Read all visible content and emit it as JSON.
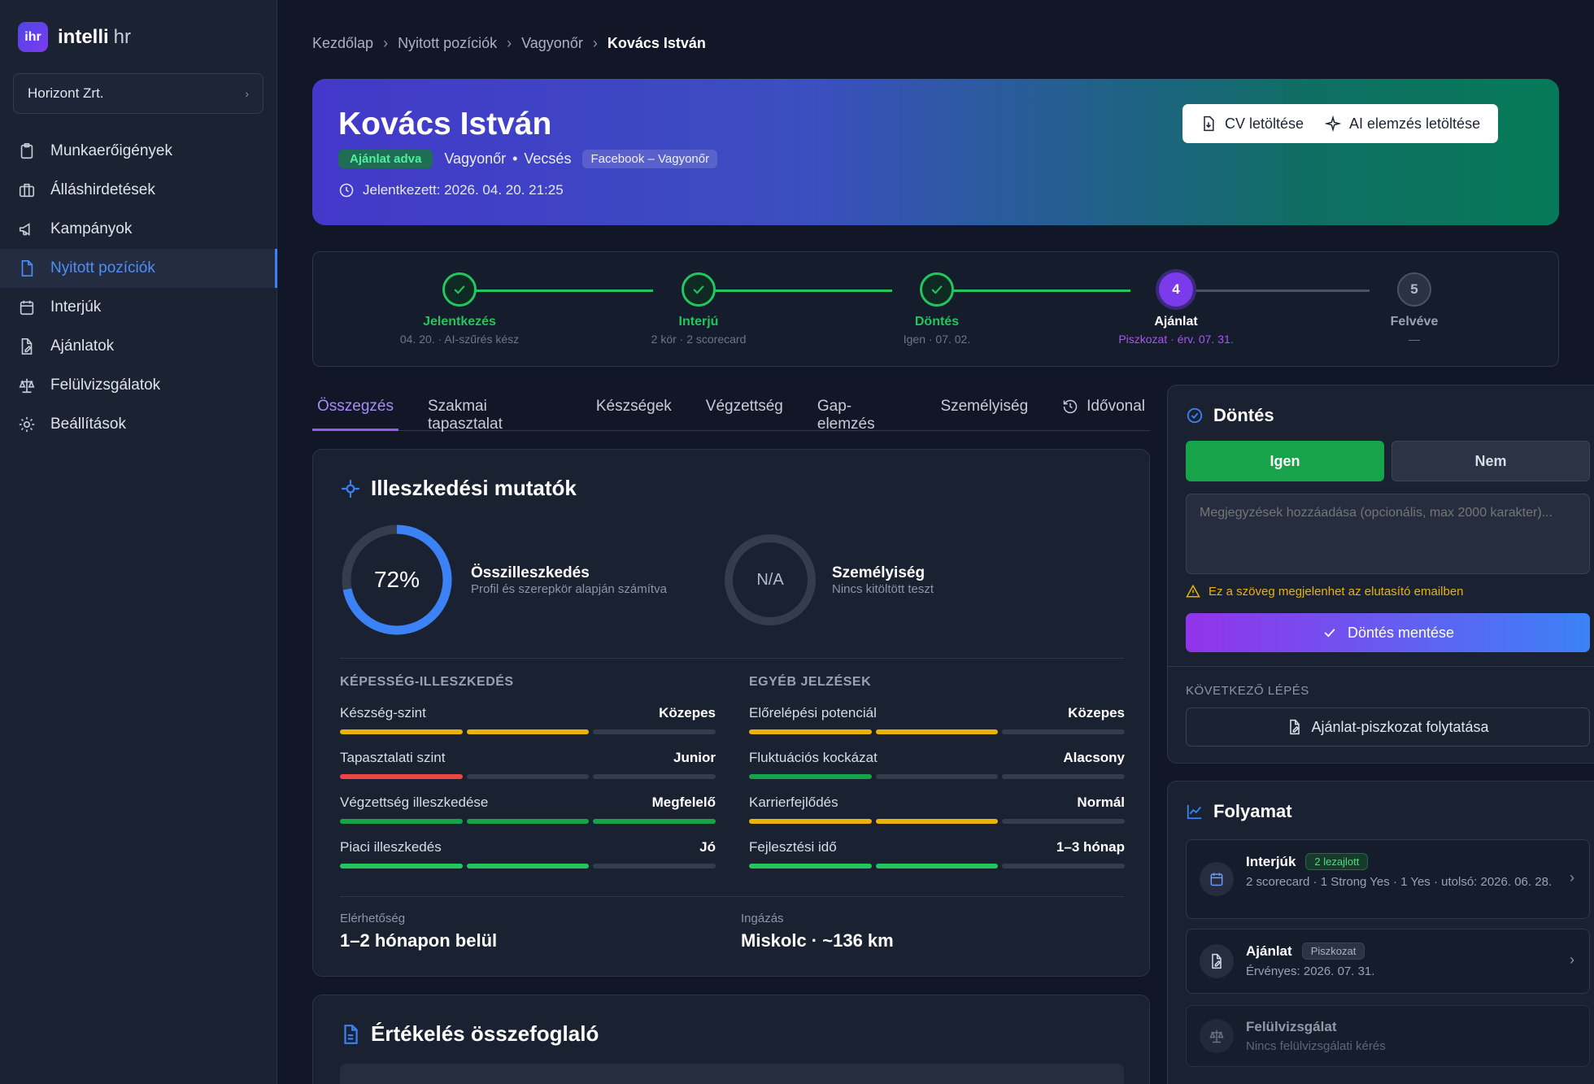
{
  "logo": {
    "badge": "ihr",
    "name": "intelli",
    "suffix": "hr"
  },
  "org": {
    "name": "Horizont Zrt.",
    "chevron": "›"
  },
  "nav": [
    {
      "label": "Munkaerőigények",
      "icon": "clipboard-icon"
    },
    {
      "label": "Álláshirdetések",
      "icon": "briefcase-icon"
    },
    {
      "label": "Kampányok",
      "icon": "megaphone-icon"
    },
    {
      "label": "Nyitott pozíciók",
      "icon": "file-icon",
      "active": true
    },
    {
      "label": "Interjúk",
      "icon": "calendar-icon"
    },
    {
      "label": "Ajánlatok",
      "icon": "file-edit-icon"
    },
    {
      "label": "Felülvizsgálatok",
      "icon": "scale-icon"
    },
    {
      "label": "Beállítások",
      "icon": "gear-icon"
    }
  ],
  "breadcrumb": {
    "items": [
      "Kezdőlap",
      "Nyitott pozíciók",
      "Vagyonőr"
    ],
    "current": "Kovács István",
    "sep": "›"
  },
  "hero": {
    "name": "Kovács István",
    "status": "Ajánlat adva",
    "role": "Vagyonőr",
    "dot": "•",
    "location": "Vecsés",
    "source": "Facebook – Vagyonőr",
    "applied": "Jelentkezett: 2026. 04. 20. 21:25",
    "btn_cv": "CV letöltése",
    "btn_ai": "AI elemzés letöltése"
  },
  "stepper": {
    "steps": [
      {
        "label": "Jelentkezés",
        "sub": "04. 20. · AI-szűrés kész",
        "state": "done"
      },
      {
        "label": "Interjú",
        "sub": "2 kör · 2 scorecard",
        "state": "done"
      },
      {
        "label": "Döntés",
        "sub": "Igen · 07. 02.",
        "state": "done"
      },
      {
        "label": "Ajánlat",
        "sub": "Piszkozat · érv. 07. 31.",
        "state": "current",
        "num": "4"
      },
      {
        "label": "Felvéve",
        "sub": "—",
        "state": "next",
        "num": "5"
      }
    ]
  },
  "tabs": [
    "Összegzés",
    "Szakmai tapasztalat",
    "Készségek",
    "Végzettség",
    "Gap-elemzés",
    "Személyiség",
    "Idővonal"
  ],
  "fit": {
    "title": "Illeszkedési mutatók",
    "overall": {
      "value": "72%",
      "percent": 72,
      "label": "Összilleszkedés",
      "sub": "Profil és szerepkör alapján számítva",
      "color": "#3b82f6"
    },
    "personality": {
      "value": "N/A",
      "label": "Személyiség",
      "sub": "Nincs kitöltött teszt"
    },
    "capability_title": "KÉPESSÉG-ILLESZKEDÉS",
    "other_title": "EGYÉB JELZÉSEK",
    "capability": [
      {
        "label": "Készség-szint",
        "value": "Közepes",
        "filled": 2,
        "color": "#eab308"
      },
      {
        "label": "Tapasztalati szint",
        "value": "Junior",
        "filled": 1,
        "color": "#ef4444"
      },
      {
        "label": "Végzettség illeszkedése",
        "value": "Megfelelő",
        "filled": 3,
        "color": "#16a34a"
      },
      {
        "label": "Piaci illeszkedés",
        "value": "Jó",
        "filled": 2,
        "color": "#22c55e"
      }
    ],
    "other": [
      {
        "label": "Előrelépési potenciál",
        "value": "Közepes",
        "filled": 2,
        "color": "#eab308"
      },
      {
        "label": "Fluktuációs kockázat",
        "value": "Alacsony",
        "filled": 1,
        "color": "#16a34a"
      },
      {
        "label": "Karrierfejlődés",
        "value": "Normál",
        "filled": 2,
        "color": "#eab308"
      },
      {
        "label": "Fejlesztési idő",
        "value": "1–3 hónap",
        "filled": 2,
        "color": "#22c55e"
      }
    ],
    "availability_label": "Elérhetőség",
    "availability": "1–2 hónapon belül",
    "commute_label": "Ingázás",
    "commute": "Miskolc · ~136 km"
  },
  "summary": {
    "title": "Értékelés összefoglaló"
  },
  "decision": {
    "title": "Döntés",
    "yes": "Igen",
    "no": "Nem",
    "note_placeholder": "Megjegyzések hozzáadása (opcionális, max 2000 karakter)...",
    "warning": "Ez a szöveg megjelenhet az elutasító emailben",
    "save": "Döntés mentése",
    "next_label": "KÖVETKEZŐ LÉPÉS",
    "next_btn": "Ajánlat-piszkozat folytatása"
  },
  "process": {
    "title": "Folyamat",
    "items": [
      {
        "title": "Interjúk",
        "badge": "2 lezajlott",
        "sub": "2 scorecard · 1 Strong Yes · 1 Yes · utolsó: 2026. 06. 28.",
        "icon": "calendar-icon",
        "chev": "›"
      },
      {
        "title": "Ajánlat",
        "badge": "Piszkozat",
        "sub": "Érvényes: 2026. 07. 31.",
        "icon": "file-edit-icon",
        "chev": "›"
      },
      {
        "title": "Felülvizsgálat",
        "sub": "Nincs felülvizsgálati kérés",
        "icon": "scale-icon"
      }
    ]
  },
  "colors": {
    "accent": "#3b82f6",
    "success": "#22c55e",
    "purple": "#7c3aed",
    "warning": "#eab308"
  }
}
